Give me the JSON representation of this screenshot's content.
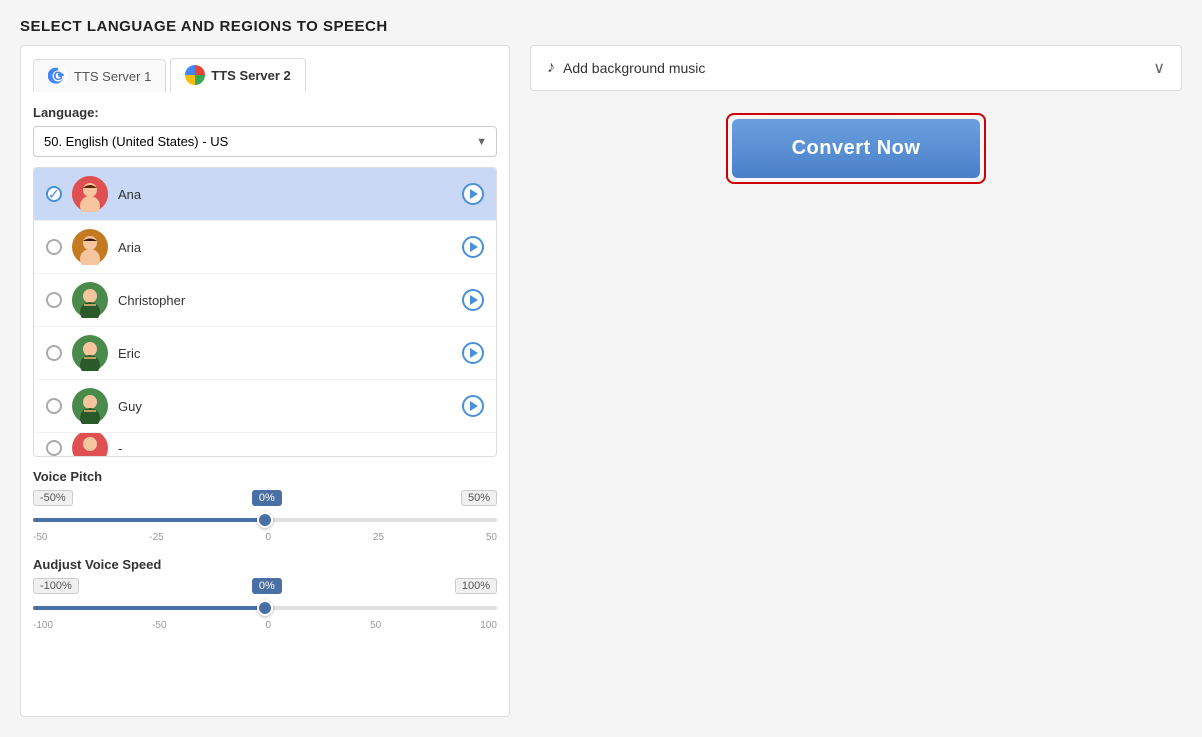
{
  "page": {
    "title": "SELECT LANGUAGE AND REGIONS TO SPEECH"
  },
  "tabs": [
    {
      "id": "server1",
      "label": "TTS Server 1",
      "icon": "google",
      "active": false
    },
    {
      "id": "server2",
      "label": "TTS Server 2",
      "icon": "grid",
      "active": true
    }
  ],
  "language": {
    "label": "Language:",
    "selected": "50. English (United States) - US",
    "options": [
      "50. English (United States) - US"
    ]
  },
  "voices": [
    {
      "id": "ana",
      "name": "Ana",
      "selected": true,
      "emoji": "👩"
    },
    {
      "id": "aria",
      "name": "Aria",
      "selected": false,
      "emoji": "👩"
    },
    {
      "id": "christopher",
      "name": "Christopher",
      "selected": false,
      "emoji": "👨"
    },
    {
      "id": "eric",
      "name": "Eric",
      "selected": false,
      "emoji": "👨"
    },
    {
      "id": "guy",
      "name": "Guy",
      "selected": false,
      "emoji": "👨"
    },
    {
      "id": "jenny",
      "name": "-",
      "selected": false,
      "emoji": "👩"
    }
  ],
  "voicePitch": {
    "title": "Voice Pitch",
    "min": "-50%",
    "current": "0%",
    "max": "50%",
    "minTick": "-50",
    "tick1": "-25",
    "tick2": "0",
    "tick3": "25",
    "maxTick": "50",
    "thumbPosition": 50
  },
  "voiceSpeed": {
    "title": "Audjust Voice Speed",
    "min": "-100%",
    "current": "0%",
    "max": "100%",
    "minTick": "-100",
    "tick1": "-50",
    "tick2": "0",
    "tick3": "50",
    "maxTick": "100",
    "thumbPosition": 50
  },
  "music": {
    "label": "Add background music"
  },
  "convert": {
    "button_label": "Convert Now"
  }
}
